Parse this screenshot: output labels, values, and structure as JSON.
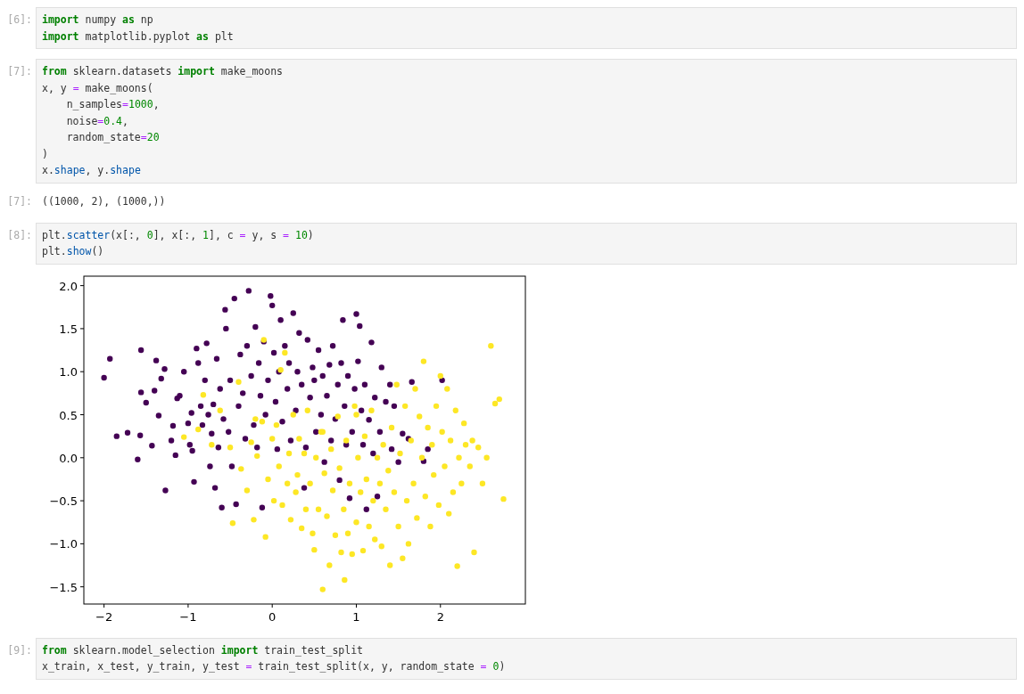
{
  "cells": [
    {
      "kind": "code",
      "prompt": "[6]:",
      "lines": [
        [
          {
            "kind": "keyword",
            "text": "import"
          },
          {
            "kind": "plain",
            "text": " numpy "
          },
          {
            "kind": "keyword",
            "text": "as"
          },
          {
            "kind": "plain",
            "text": " np"
          }
        ],
        [
          {
            "kind": "keyword",
            "text": "import"
          },
          {
            "kind": "plain",
            "text": " matplotlib.pyplot "
          },
          {
            "kind": "keyword",
            "text": "as"
          },
          {
            "kind": "plain",
            "text": " plt"
          }
        ]
      ]
    },
    {
      "kind": "code",
      "prompt": "[7]:",
      "lines": [
        [
          {
            "kind": "keyword",
            "text": "from"
          },
          {
            "kind": "plain",
            "text": " sklearn.datasets "
          },
          {
            "kind": "keyword",
            "text": "import"
          },
          {
            "kind": "plain",
            "text": " make_moons"
          }
        ],
        [
          {
            "kind": "plain",
            "text": "x, y "
          },
          {
            "kind": "operator",
            "text": "="
          },
          {
            "kind": "plain",
            "text": " make_moons("
          }
        ],
        [
          {
            "kind": "plain",
            "text": "    n_samples"
          },
          {
            "kind": "operator",
            "text": "="
          },
          {
            "kind": "number",
            "text": "1000"
          },
          {
            "kind": "plain",
            "text": ","
          }
        ],
        [
          {
            "kind": "plain",
            "text": "    noise"
          },
          {
            "kind": "operator",
            "text": "="
          },
          {
            "kind": "number",
            "text": "0.4"
          },
          {
            "kind": "plain",
            "text": ","
          }
        ],
        [
          {
            "kind": "plain",
            "text": "    random_state"
          },
          {
            "kind": "operator",
            "text": "="
          },
          {
            "kind": "number",
            "text": "20"
          }
        ],
        [
          {
            "kind": "plain",
            "text": ")"
          }
        ],
        [
          {
            "kind": "plain",
            "text": "x."
          },
          {
            "kind": "attribute",
            "text": "shape"
          },
          {
            "kind": "plain",
            "text": ", y."
          },
          {
            "kind": "attribute",
            "text": "shape"
          }
        ]
      ]
    },
    {
      "kind": "output",
      "prompt": "[7]:",
      "text": "((1000, 2), (1000,))"
    },
    {
      "kind": "code",
      "prompt": "[8]:",
      "lines": [
        [
          {
            "kind": "plain",
            "text": "plt."
          },
          {
            "kind": "attribute",
            "text": "scatter"
          },
          {
            "kind": "plain",
            "text": "(x[:, "
          },
          {
            "kind": "number",
            "text": "0"
          },
          {
            "kind": "plain",
            "text": "], x[:, "
          },
          {
            "kind": "number",
            "text": "1"
          },
          {
            "kind": "plain",
            "text": "], c "
          },
          {
            "kind": "operator",
            "text": "="
          },
          {
            "kind": "plain",
            "text": " y, s "
          },
          {
            "kind": "operator",
            "text": "="
          },
          {
            "kind": "number",
            "text": " 10"
          },
          {
            "kind": "plain",
            "text": ")"
          }
        ],
        [
          {
            "kind": "plain",
            "text": "plt."
          },
          {
            "kind": "attribute",
            "text": "show"
          },
          {
            "kind": "plain",
            "text": "()"
          }
        ]
      ]
    },
    {
      "kind": "plot",
      "chart_data": {
        "type": "scatter",
        "xlim": [
          -2.24,
          3.01
        ],
        "ylim": [
          -1.7,
          2.11
        ],
        "xticks": [
          {
            "value": -2,
            "label": "−2"
          },
          {
            "value": -1,
            "label": "−1"
          },
          {
            "value": 0,
            "label": "0"
          },
          {
            "value": 1,
            "label": "1"
          },
          {
            "value": 2,
            "label": "2"
          }
        ],
        "yticks": [
          {
            "value": 2,
            "label": "2.0"
          },
          {
            "value": 1.5,
            "label": "1.5"
          },
          {
            "value": 1,
            "label": "1.0"
          },
          {
            "value": 0.5,
            "label": "0.5"
          },
          {
            "value": 0,
            "label": "0.0"
          },
          {
            "value": -0.5,
            "label": "−0.5"
          },
          {
            "value": -1,
            "label": "−1.0"
          },
          {
            "value": -1.5,
            "label": "−1.5"
          }
        ],
        "series": [
          {
            "color": "#440154",
            "x": [
              -2.0,
              -1.93,
              -1.85,
              -1.72,
              -1.6,
              -1.57,
              -1.56,
              -1.56,
              -1.5,
              -1.43,
              -1.4,
              -1.38,
              -1.35,
              -1.32,
              -1.28,
              -1.27,
              -1.2,
              -1.18,
              -1.15,
              -1.13,
              -1.1,
              -1.05,
              -1.0,
              -0.98,
              -0.96,
              -0.95,
              -0.93,
              -0.9,
              -0.88,
              -0.85,
              -0.83,
              -0.8,
              -0.78,
              -0.76,
              -0.74,
              -0.72,
              -0.7,
              -0.68,
              -0.66,
              -0.64,
              -0.62,
              -0.6,
              -0.58,
              -0.56,
              -0.55,
              -0.52,
              -0.5,
              -0.48,
              -0.45,
              -0.43,
              -0.4,
              -0.38,
              -0.35,
              -0.32,
              -0.3,
              -0.28,
              -0.25,
              -0.22,
              -0.2,
              -0.18,
              -0.16,
              -0.14,
              -0.12,
              -0.1,
              -0.08,
              -0.05,
              -0.02,
              0.0,
              0.02,
              0.04,
              0.06,
              0.08,
              0.1,
              0.12,
              0.15,
              0.18,
              0.2,
              0.22,
              0.25,
              0.28,
              0.3,
              0.32,
              0.35,
              0.38,
              0.4,
              0.42,
              0.45,
              0.48,
              0.5,
              0.52,
              0.55,
              0.58,
              0.6,
              0.62,
              0.65,
              0.68,
              0.7,
              0.72,
              0.75,
              0.78,
              0.8,
              0.82,
              0.84,
              0.86,
              0.88,
              0.9,
              0.92,
              0.95,
              0.98,
              1.0,
              1.02,
              1.04,
              1.06,
              1.08,
              1.1,
              1.12,
              1.15,
              1.18,
              1.2,
              1.22,
              1.25,
              1.28,
              1.3,
              1.35,
              1.4,
              1.42,
              1.45,
              1.5,
              1.55,
              1.62,
              1.66,
              1.8,
              1.85,
              2.02
            ],
            "values": [
              0.93,
              1.15,
              0.25,
              0.29,
              -0.02,
              0.26,
              1.25,
              0.76,
              0.64,
              0.14,
              0.78,
              1.13,
              0.49,
              0.92,
              1.03,
              -0.38,
              0.2,
              0.37,
              0.03,
              0.69,
              0.72,
              1.0,
              0.4,
              0.15,
              0.52,
              0.08,
              -0.28,
              1.27,
              1.1,
              0.6,
              0.38,
              0.9,
              1.33,
              0.5,
              -0.1,
              0.28,
              0.62,
              -0.35,
              1.15,
              0.12,
              0.8,
              -0.58,
              0.45,
              1.72,
              1.5,
              0.3,
              0.9,
              -0.1,
              1.85,
              -0.54,
              0.6,
              1.2,
              0.75,
              0.22,
              1.3,
              1.94,
              0.95,
              0.38,
              1.52,
              0.12,
              1.1,
              0.72,
              -0.58,
              1.35,
              0.5,
              0.9,
              1.88,
              1.77,
              1.22,
              0.65,
              0.1,
              1.0,
              1.6,
              0.42,
              1.3,
              0.8,
              1.1,
              0.2,
              1.68,
              0.55,
              1.0,
              1.45,
              0.85,
              -0.35,
              0.12,
              1.37,
              0.7,
              1.05,
              0.9,
              0.3,
              1.25,
              0.5,
              0.95,
              -0.05,
              0.72,
              1.08,
              0.2,
              1.3,
              0.45,
              0.85,
              -0.26,
              1.1,
              1.6,
              0.6,
              0.15,
              0.95,
              -0.47,
              0.3,
              0.8,
              1.67,
              1.12,
              1.53,
              0.55,
              0.15,
              0.85,
              -0.6,
              0.44,
              1.34,
              0.05,
              0.7,
              -0.45,
              0.3,
              1.05,
              0.65,
              0.85,
              0.1,
              0.6,
              -0.05,
              0.28,
              0.22,
              0.88,
              -0.04,
              0.1,
              0.9
            ]
          },
          {
            "color": "#fde725",
            "x": [
              -1.05,
              -0.88,
              -0.82,
              -0.72,
              -0.62,
              -0.5,
              -0.47,
              -0.4,
              -0.37,
              -0.3,
              -0.25,
              -0.22,
              -0.18,
              -0.12,
              -0.1,
              -0.08,
              -0.05,
              0.0,
              0.02,
              0.05,
              0.08,
              0.1,
              0.12,
              0.15,
              0.18,
              0.2,
              0.22,
              0.25,
              0.28,
              0.3,
              0.32,
              0.35,
              0.38,
              0.4,
              0.42,
              0.45,
              0.48,
              0.5,
              0.52,
              0.55,
              0.58,
              0.6,
              0.62,
              0.65,
              0.68,
              0.7,
              0.72,
              0.75,
              0.78,
              0.8,
              0.82,
              0.85,
              0.86,
              0.88,
              0.9,
              0.92,
              0.95,
              0.98,
              1.0,
              1.02,
              1.05,
              1.08,
              1.1,
              1.12,
              1.15,
              1.18,
              1.2,
              1.22,
              1.25,
              1.28,
              1.3,
              1.32,
              1.35,
              1.38,
              1.4,
              1.42,
              1.45,
              1.48,
              1.5,
              1.52,
              1.55,
              1.58,
              1.6,
              1.62,
              1.65,
              1.68,
              1.7,
              1.72,
              1.75,
              1.78,
              1.8,
              1.82,
              1.85,
              1.88,
              1.9,
              1.92,
              1.95,
              1.98,
              2.0,
              2.02,
              2.05,
              2.08,
              2.1,
              2.12,
              2.15,
              2.18,
              2.2,
              2.22,
              2.25,
              2.28,
              2.3,
              2.35,
              2.38,
              2.4,
              2.45,
              2.5,
              2.55,
              2.6,
              2.65,
              2.7,
              2.75,
              1.0,
              0.6,
              -0.2
            ],
            "values": [
              0.24,
              0.33,
              0.73,
              0.15,
              0.55,
              0.12,
              -0.76,
              0.88,
              -0.13,
              -0.38,
              0.18,
              -0.72,
              0.02,
              0.42,
              1.37,
              -0.92,
              -0.25,
              0.22,
              -0.5,
              0.38,
              -0.1,
              1.02,
              -0.55,
              1.22,
              -0.3,
              0.05,
              -0.72,
              0.5,
              -0.4,
              -0.2,
              0.22,
              -0.82,
              0.05,
              -0.6,
              0.55,
              -0.3,
              -0.88,
              -1.07,
              0.0,
              -0.6,
              0.3,
              -1.53,
              -0.18,
              -0.68,
              -1.25,
              0.1,
              -0.38,
              -0.9,
              0.48,
              -0.12,
              -1.1,
              -0.6,
              -1.42,
              0.2,
              -0.88,
              -0.3,
              -1.12,
              0.6,
              -0.75,
              0.0,
              -0.4,
              -1.08,
              0.25,
              -0.25,
              -0.8,
              0.55,
              -0.5,
              -0.95,
              0.0,
              -0.3,
              -1.03,
              0.15,
              -0.6,
              -0.15,
              -1.25,
              0.35,
              -0.4,
              0.85,
              -0.8,
              0.05,
              -1.17,
              0.6,
              -0.5,
              -1.0,
              0.2,
              -0.3,
              0.8,
              -0.7,
              0.48,
              0.0,
              1.12,
              -0.45,
              0.35,
              -0.8,
              0.15,
              -0.2,
              0.6,
              -0.55,
              0.95,
              0.3,
              -0.1,
              0.8,
              -0.65,
              0.2,
              -0.4,
              0.55,
              -1.26,
              0.0,
              -0.3,
              0.4,
              0.15,
              -0.1,
              0.2,
              -1.1,
              0.12,
              -0.3,
              0.0,
              1.3,
              0.63,
              0.68,
              -0.48,
              0.5,
              0.3,
              0.45
            ]
          }
        ]
      }
    },
    {
      "kind": "code",
      "prompt": "[9]:",
      "lines": [
        [
          {
            "kind": "keyword",
            "text": "from"
          },
          {
            "kind": "plain",
            "text": " sklearn.model_selection "
          },
          {
            "kind": "keyword",
            "text": "import"
          },
          {
            "kind": "plain",
            "text": " train_test_split"
          }
        ],
        [
          {
            "kind": "plain",
            "text": "x_train, x_test, y_train, y_test "
          },
          {
            "kind": "operator",
            "text": "="
          },
          {
            "kind": "plain",
            "text": " train_test_split(x, y, random_state "
          },
          {
            "kind": "operator",
            "text": "="
          },
          {
            "kind": "number",
            "text": " 0"
          },
          {
            "kind": "plain",
            "text": ")"
          }
        ]
      ]
    }
  ]
}
